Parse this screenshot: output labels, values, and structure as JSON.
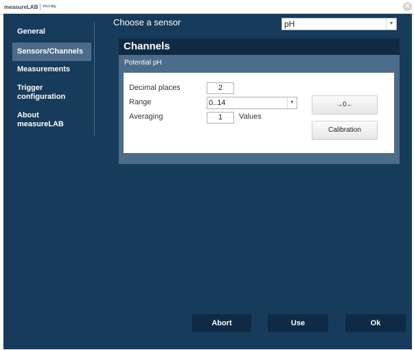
{
  "app": {
    "logo_text": "measureLAB",
    "logo_sub": "PHYWE",
    "close_glyph": "✕"
  },
  "sidebar": {
    "items": [
      {
        "label": "General"
      },
      {
        "label": "Sensors/Channels",
        "active": true
      },
      {
        "label": "Measurements"
      },
      {
        "label": "Trigger configuration",
        "line1": "Trigger",
        "line2": "configuration"
      },
      {
        "label": "About measureLAB",
        "line1": "About",
        "line2": "measureLAB"
      }
    ]
  },
  "sensor": {
    "label": "Choose a sensor",
    "value": "pH"
  },
  "channels": {
    "title": "Channels",
    "channel_name": "Potential pH",
    "decimal_places_label": "Decimal places",
    "decimal_places_value": "2",
    "range_label": "Range",
    "range_value": "0..14",
    "averaging_label": "Averaging",
    "averaging_value": "1",
    "averaging_unit": "Values",
    "zero_button_label": "→0←",
    "calibration_button_label": "Calibration"
  },
  "footer": {
    "abort_label": "Abort",
    "use_label": "Use",
    "ok_label": "Ok"
  },
  "colors": {
    "background": "#173b5a",
    "header_dark": "#0f2a44",
    "panel": "#4c6c8a"
  },
  "icons": {
    "dropdown": "chevron-down-icon",
    "close": "close-icon"
  }
}
